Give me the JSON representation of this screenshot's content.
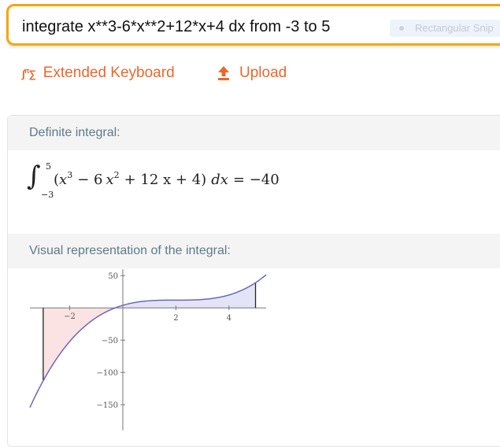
{
  "search": {
    "query": "integrate x**3-6*x**2+12*x+4 dx from -3 to 5",
    "tag_label": "Rectangular Snip"
  },
  "toolbar": {
    "keyboard_label": "Extended Keyboard",
    "upload_label": "Upload"
  },
  "pods": {
    "definite": {
      "title": "Definite integral:",
      "lower": "−3",
      "upper": "5",
      "integrand_open": "(",
      "t1_base": "x",
      "t1_exp": "3",
      "t2": "− 6",
      "t2_base": "x",
      "t2_exp": "2",
      "t3": "+ 12 x + 4",
      "integrand_close": ")",
      "d": "d",
      "dx": "x",
      "eq": "= −40"
    },
    "visual": {
      "title": "Visual representation of the integral:"
    }
  },
  "colors": {
    "accent": "#e9672e",
    "search_border": "#f7a600",
    "header_text": "#5d7a8c",
    "curve": "#6a67c0",
    "area_negative": "#fbe3e3",
    "area_positive": "#e4e4f8"
  },
  "chart_data": {
    "type": "area",
    "function": "x^3 - 6x^2 + 12x + 4",
    "x_range": [
      -3.5,
      5.4
    ],
    "y_range": [
      -190,
      60
    ],
    "shaded_interval": [
      -3,
      5
    ],
    "x_ticks": [
      -2,
      2,
      4
    ],
    "y_ticks": [
      50,
      -50,
      -100,
      -150
    ]
  }
}
